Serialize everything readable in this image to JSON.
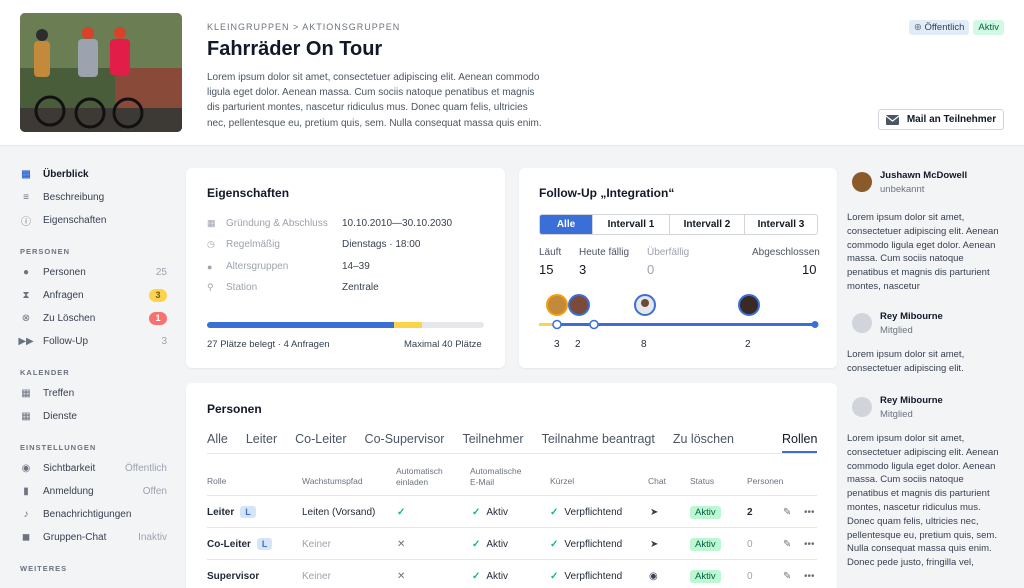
{
  "header": {
    "breadcrumb": "KLEINGRUPPEN > AKTIONSGRUPPEN",
    "title": "Fahrräder On Tour",
    "description": "Lorem ipsum dolor sit amet, consectetuer adipiscing elit. Aenean commodo ligula eget dolor. Aenean massa. Cum sociis natoque penatibus et magnis dis parturient montes, nascetur ridiculus mus. Donec quam felis, ultricies nec, pellentesque eu, pretium quis, sem. Nulla consequat massa quis enim.",
    "badge_public": "Öffentlich",
    "badge_active": "Aktiv",
    "mail_button": "Mail an Teilnehmer"
  },
  "sidebar": {
    "main": [
      {
        "label": "Überblick",
        "icon": "grid-icon"
      },
      {
        "label": "Beschreibung",
        "icon": "lines-icon"
      },
      {
        "label": "Eigenschaften",
        "icon": "info-icon"
      }
    ],
    "personen_head": "PERSONEN",
    "personen": [
      {
        "label": "Personen",
        "count": "25"
      },
      {
        "label": "Anfragen",
        "count": "3"
      },
      {
        "label": "Zu Löschen",
        "count": "1"
      },
      {
        "label": "Follow-Up",
        "count": "3"
      }
    ],
    "kalender_head": "KALENDER",
    "kalender": [
      {
        "label": "Treffen"
      },
      {
        "label": "Dienste"
      }
    ],
    "einst_head": "EINSTELLUNGEN",
    "einst": [
      {
        "label": "Sichtbarkeit",
        "value": "Öffentlich"
      },
      {
        "label": "Anmeldung",
        "value": "Offen"
      },
      {
        "label": "Benachrichtigungen",
        "value": ""
      },
      {
        "label": "Gruppen-Chat",
        "value": "Inaktiv"
      }
    ],
    "weiteres_head": "WEITERES"
  },
  "props": {
    "title": "Eigenschaften",
    "rows": [
      {
        "k": "Gründung & Abschluss",
        "v": "10.10.2010—30.10.2030"
      },
      {
        "k": "Regelmäßig",
        "v": "Dienstags · 18:00"
      },
      {
        "k": "Altersgruppen",
        "v": "14–39"
      },
      {
        "k": "Station",
        "v": "Zentrale"
      }
    ],
    "progress_left": "27 Plätze belegt · 4 Anfragen",
    "progress_right": "Maximal 40 Plätze",
    "filled": 27,
    "requests": 4,
    "max": 40
  },
  "followup": {
    "title": "Follow-Up „Integration“",
    "tabs": [
      "Alle",
      "Intervall 1",
      "Intervall 2",
      "Intervall 3"
    ],
    "stats": [
      {
        "label": "Läuft",
        "value": "15"
      },
      {
        "label": "Heute fällig",
        "value": "3"
      },
      {
        "label": "Überfällig",
        "value": "0"
      },
      {
        "label": "Abgeschlossen",
        "value": "10"
      }
    ],
    "timeline_counts": [
      "3",
      "2",
      "8",
      "2"
    ]
  },
  "persons": {
    "title": "Personen",
    "tabs": [
      "Alle",
      "Leiter",
      "Co-Leiter",
      "Co-Supervisor",
      "Teilnehmer",
      "Teilnahme beantragt",
      "Zu löschen",
      "Rollen"
    ],
    "headers": [
      "Rolle",
      "Wachstumspfad",
      "Automatisch einladen",
      "Automatische E-Mail",
      "Kürzel",
      "Chat",
      "Status",
      "Personen"
    ],
    "rows": [
      {
        "role": "Leiter",
        "badge": "L",
        "path": "Leiten (Vorsand)",
        "invite": "✓",
        "email": "Aktiv",
        "kuerzel": "Verpflichtend",
        "status": "Aktiv",
        "count": "2"
      },
      {
        "role": "Co-Leiter",
        "badge": "L",
        "path": "Keiner",
        "invite": "✕",
        "email": "Aktiv",
        "kuerzel": "Verpflichtend",
        "status": "Aktiv",
        "count": "0"
      },
      {
        "role": "Supervisor",
        "badge": "",
        "path": "Keiner",
        "invite": "✕",
        "email": "Aktiv",
        "kuerzel": "Verpflichtend",
        "status": "Aktiv",
        "count": "0"
      }
    ]
  },
  "activity": [
    {
      "name": "Jushawn McDowell",
      "sub": "unbekannt",
      "text": "Lorem ipsum dolor sit amet, consectetuer adipiscing elit. Aenean commodo ligula eget dolor. Aenean massa. Cum sociis natoque penatibus et magnis dis parturient montes, nascetur"
    },
    {
      "name": "Rey Mibourne",
      "sub": "Mitglied",
      "text": "Lorem ipsum dolor sit amet, consectetuer adipiscing elit."
    },
    {
      "name": "Rey Mibourne",
      "sub": "Mitglied",
      "text": "Lorem ipsum dolor sit amet, consectetuer adipiscing elit. Aenean commodo ligula eget dolor. Aenean massa. Cum sociis natoque penatibus et magnis dis parturient montes, nascetur ridiculus mus. Donec quam felis, ultricies nec, pellentesque eu, pretium quis, sem. Nulla consequat massa quis enim. Donec pede justo, fringilla vel,"
    }
  ]
}
